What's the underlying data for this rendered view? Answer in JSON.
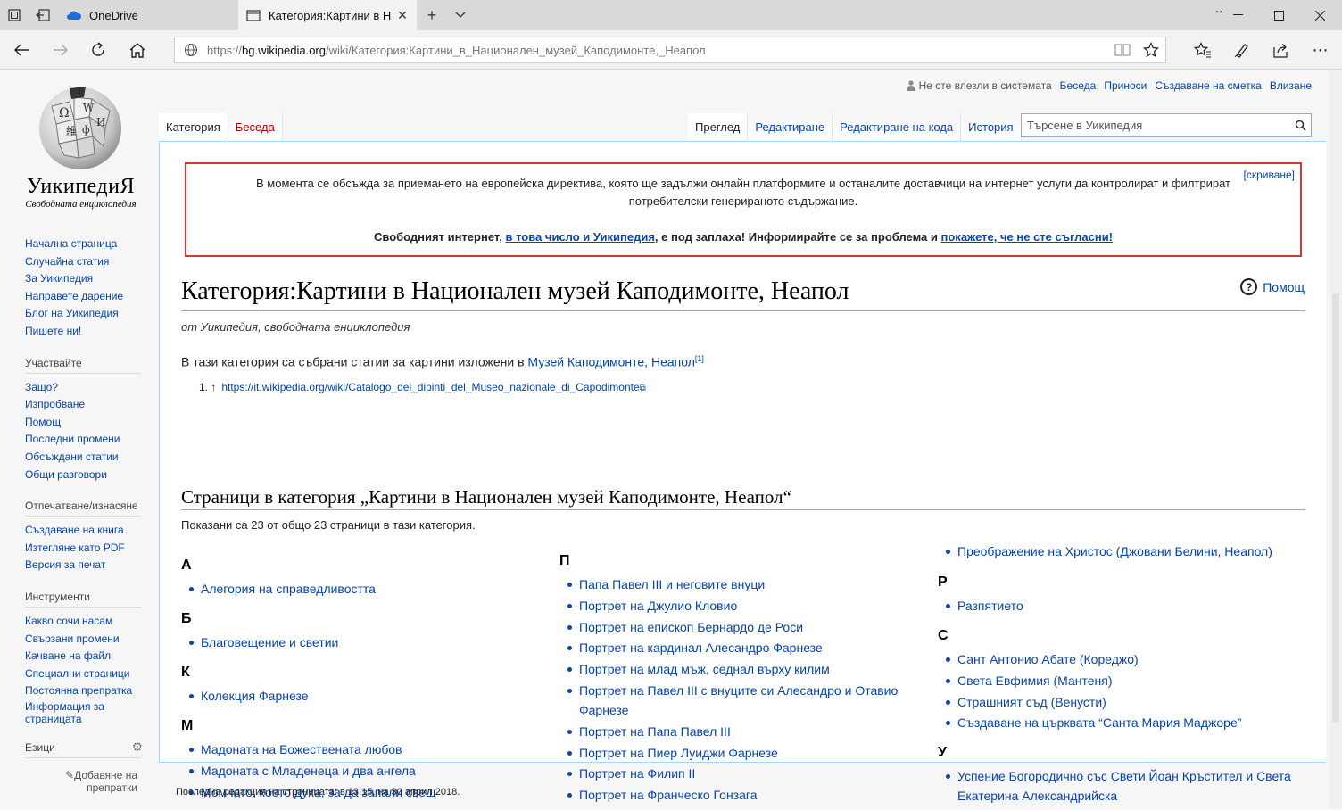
{
  "browser": {
    "tabs": [
      {
        "title": "OneDrive",
        "icon": "onedrive-icon"
      },
      {
        "title": "Категория:Картини в Н",
        "icon": "page-icon"
      }
    ],
    "url_prefix": "https://",
    "url_domain": "bg.wikipedia.org",
    "url_path": "/wiki/Категория:Картини_в_Национален_музей_Каподимонте,_Неапол"
  },
  "logo": {
    "wordmark": "УикипедиЯ",
    "tagline": "Свободната енциклопедия"
  },
  "personal": {
    "anon": "Не сте влезли в системата",
    "talk": "Беседа",
    "contribs": "Приноси",
    "create": "Създаване на сметка",
    "login": "Влизане"
  },
  "tabs": {
    "category": "Категория",
    "talk": "Беседа",
    "read": "Преглед",
    "edit": "Редактиране",
    "editsource": "Редактиране на кода",
    "history": "История"
  },
  "search": {
    "placeholder": "Търсене в Уикипедия"
  },
  "sidebar": {
    "nav": [
      "Начална страница",
      "Случайна статия",
      "За Уикипедия",
      "Направете дарение",
      "Блог на Уикипедия",
      "Пишете ни!"
    ],
    "participate_head": "Участвайте",
    "participate": [
      "Защо?",
      "Изпробване",
      "Помощ",
      "Последни промени",
      "Обсъждани статии",
      "Общи разговори"
    ],
    "print_head": "Отпечатване/изнасяне",
    "print": [
      "Създаване на книга",
      "Изтегляне като PDF",
      "Версия за печат"
    ],
    "tools_head": "Инструменти",
    "tools": [
      "Какво сочи насам",
      "Свързани промени",
      "Качване на файл",
      "Специални страници",
      "Постоянна препратка",
      "Информация за страницата"
    ],
    "lang_head": "Езици",
    "lang_add": "Добавяне на препратки"
  },
  "banner": {
    "hide": "[скриване]",
    "line1": "В момента се обсъжда за приемането на европейска директива, която ще задължи онлайн платформите и останалите доставчици на интернет услуги да контролират и филтрират потребителски генерираното съдържание.",
    "l3a": "Свободният интернет, ",
    "l3link1": "в това число и Уикипедия",
    "l3b": ", е под заплаха! Информирайте се за проблема и ",
    "l3link2": "покажете, че не сте съгласни!"
  },
  "page": {
    "title": "Категория:Картини в Национален музей Каподимонте, Неапол",
    "help": "Помощ",
    "sitesub": "от Уикипедия, свободната енциклопедия",
    "intro": "В тази категория са събрани статии за картини изложени в ",
    "intro_link": "Музей Каподимонте, Неапол",
    "intro_ref": "[1]",
    "ref_num": "1. ↑",
    "ref_link": "https://it.wikipedia.org/wiki/Catalogo_dei_dipinti_del_Museo_nazionale_di_Capodimonte",
    "pages_head": "Страници в категория „Картини в Национален музей Каподимонте, Неапол“",
    "count": "Показани са 23 от общо 23 страници в тази категория."
  },
  "columns": [
    [
      {
        "letter": "А",
        "items": [
          "Алегория на справедливостта"
        ]
      },
      {
        "letter": "Б",
        "items": [
          "Благовещение и светии"
        ]
      },
      {
        "letter": "К",
        "items": [
          "Колекция Фарнезе"
        ]
      },
      {
        "letter": "М",
        "items": [
          "Мадоната на Божествената любов",
          "Мадоната с Младенеца и два ангела",
          "Момчето, което духа, за да запали свещ"
        ]
      }
    ],
    [
      {
        "letter": "П",
        "items": [
          "Папа Павел III и неговите внуци",
          "Портрет на Джулио Кловио",
          "Портрет на епископ Бернардо де Роси",
          "Портрет на кардинал Алесандро Фарнезе",
          "Портрет на млад мъж, седнал върху килим",
          "Портрет на Павел III с внуците си Алесандро и Отавио Фарнезе",
          "Портрет на Папа Павел III",
          "Портрет на Пиер Луиджи Фарнезе",
          "Портрет на Филип II",
          "Портрет на Франческо Гонзага"
        ]
      }
    ],
    [
      {
        "letter": "",
        "items": [
          "Преображение на Христос (Джовани Белини, Неапол)"
        ]
      },
      {
        "letter": "Р",
        "items": [
          "Разпятието"
        ]
      },
      {
        "letter": "С",
        "items": [
          "Сант Антонио Абате (Кореджо)",
          "Света Евфимия (Мантеня)",
          "Страшният съд (Венусти)",
          "Създаване на църквата “Санта Мария Маджоре”"
        ]
      },
      {
        "letter": "У",
        "items": [
          "Успение Богородично със Свети Йоан Кръстител и Света Екатерина Александрийска"
        ]
      }
    ]
  ],
  "footer": "Последна редакция на страницата: в 13:15, на 30 април 2018."
}
